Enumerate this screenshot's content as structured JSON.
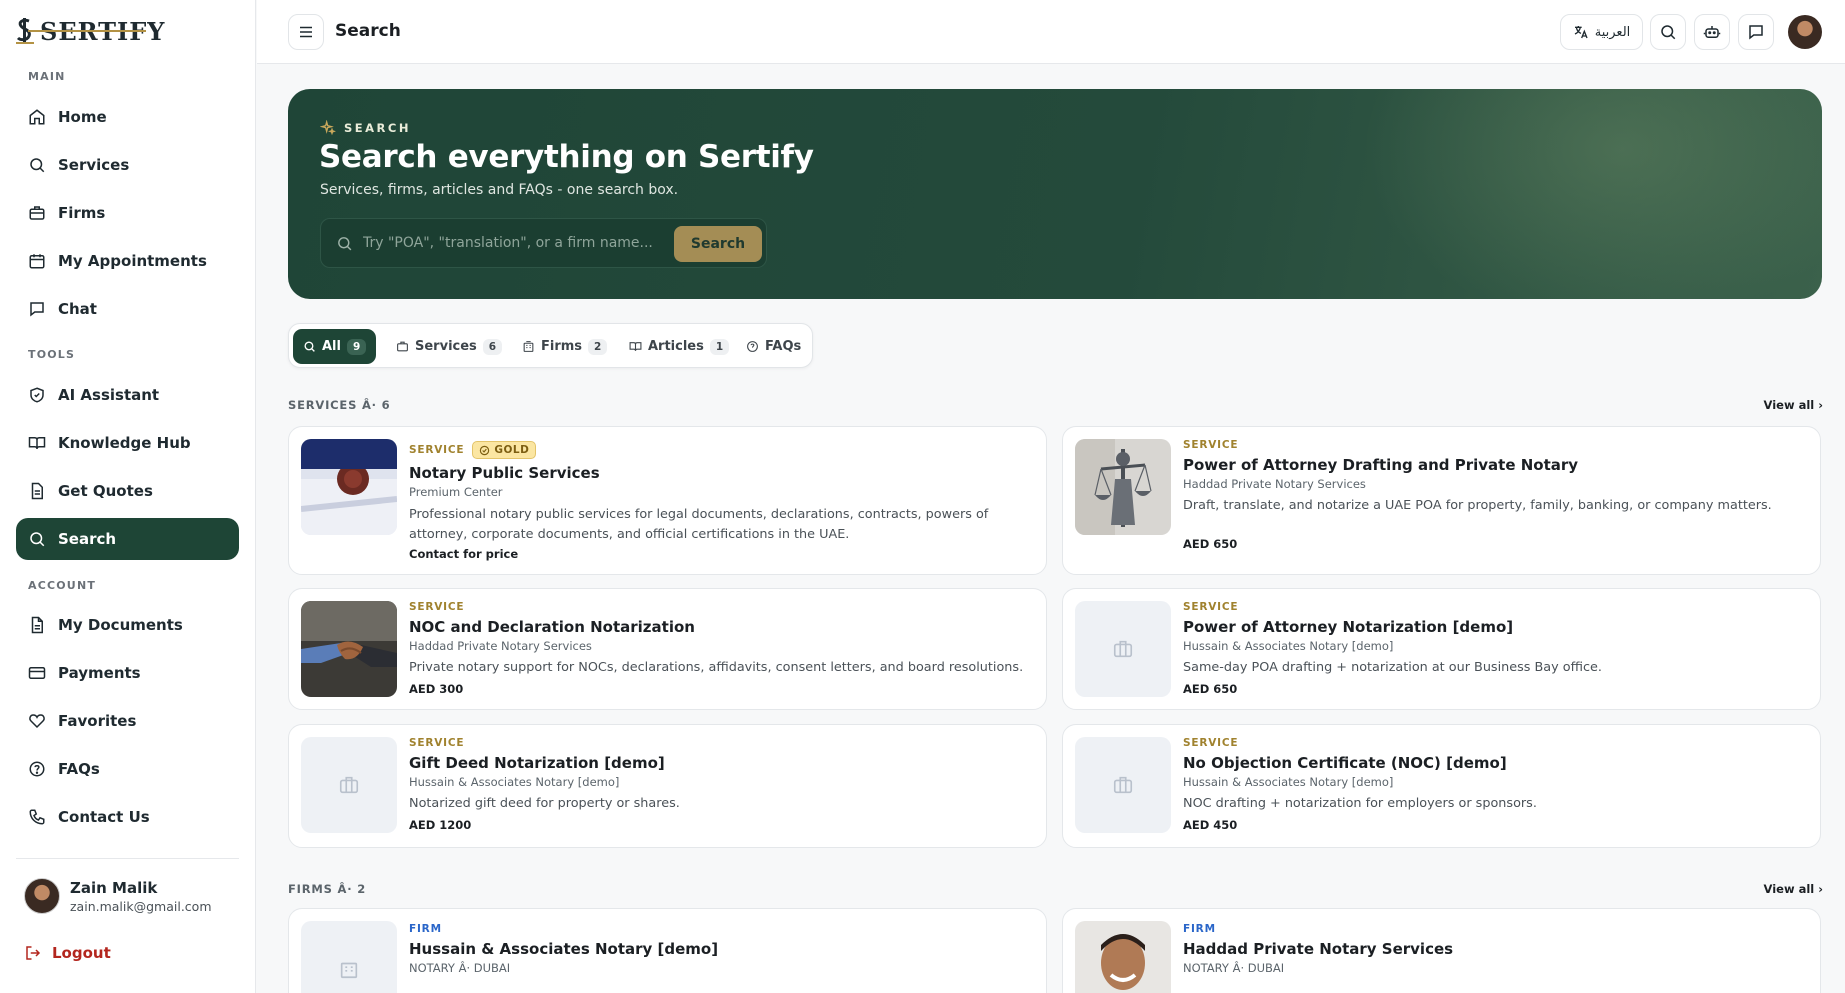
{
  "brand": {
    "name": "SERTIFY"
  },
  "sidebar": {
    "sections": {
      "main": "MAIN",
      "tools": "TOOLS",
      "account": "ACCOUNT"
    },
    "items": [
      {
        "label": "Home",
        "icon": "home-icon"
      },
      {
        "label": "Services",
        "icon": "search-icon"
      },
      {
        "label": "Firms",
        "icon": "briefcase-icon"
      },
      {
        "label": "My Appointments",
        "icon": "calendar-icon"
      },
      {
        "label": "Chat",
        "icon": "chat-icon"
      },
      {
        "label": "AI Assistant",
        "icon": "shield-icon"
      },
      {
        "label": "Knowledge Hub",
        "icon": "book-icon"
      },
      {
        "label": "Get Quotes",
        "icon": "document-icon"
      },
      {
        "label": "Search",
        "icon": "search-icon",
        "active": true
      },
      {
        "label": "My Documents",
        "icon": "file-icon"
      },
      {
        "label": "Payments",
        "icon": "credit-card-icon"
      },
      {
        "label": "Favorites",
        "icon": "heart-icon"
      },
      {
        "label": "FAQs",
        "icon": "help-circle-icon"
      },
      {
        "label": "Contact Us",
        "icon": "phone-icon"
      }
    ],
    "user": {
      "name": "Zain Malik",
      "email": "zain.malik@gmail.com"
    },
    "logout_label": "Logout"
  },
  "topbar": {
    "title": "Search",
    "language_label": "العربية"
  },
  "hero": {
    "eyebrow": "SEARCH",
    "title": "Search everything on Sertify",
    "subtitle": "Services, firms, articles and FAQs - one search box.",
    "search_placeholder": "Try \"POA\", \"translation\", or a firm name...",
    "search_button": "Search"
  },
  "tabs": [
    {
      "label": "All",
      "count": "9",
      "active": true
    },
    {
      "label": "Services",
      "count": "6"
    },
    {
      "label": "Firms",
      "count": "2"
    },
    {
      "label": "Articles",
      "count": "1"
    },
    {
      "label": "FAQs",
      "count": ""
    }
  ],
  "services_section": {
    "heading": "SERVICES Â· 6",
    "view_all": "View all",
    "cards": [
      {
        "kind": "SERVICE",
        "badge": "GOLD",
        "title": "Notary Public Services",
        "provider": "Premium Center",
        "description": "Professional notary public services for legal documents, declarations, contracts, powers of attorney, corporate documents, and official certifications in the UAE.",
        "price": "Contact for price"
      },
      {
        "kind": "SERVICE",
        "title": "Power of Attorney Drafting and Private Notary",
        "provider": "Haddad Private Notary Services",
        "description": "Draft, translate, and notarize a UAE POA for property, family, banking, or company matters.",
        "price": "AED 650"
      },
      {
        "kind": "SERVICE",
        "title": "NOC and Declaration Notarization",
        "provider": "Haddad Private Notary Services",
        "description": "Private notary support for NOCs, declarations, affidavits, consent letters, and board resolutions.",
        "price": "AED 300"
      },
      {
        "kind": "SERVICE",
        "title": "Power of Attorney Notarization [demo]",
        "provider": "Hussain & Associates Notary [demo]",
        "description": "Same-day POA drafting + notarization at our Business Bay office.",
        "price": "AED 650"
      },
      {
        "kind": "SERVICE",
        "title": "Gift Deed Notarization [demo]",
        "provider": "Hussain & Associates Notary [demo]",
        "description": "Notarized gift deed for property or shares.",
        "price": "AED 1200"
      },
      {
        "kind": "SERVICE",
        "title": "No Objection Certificate (NOC) [demo]",
        "provider": "Hussain & Associates Notary [demo]",
        "description": "NOC drafting + notarization for employers or sponsors.",
        "price": "AED 450"
      }
    ]
  },
  "firms_section": {
    "heading": "FIRMS Â· 2",
    "view_all": "View all",
    "cards": [
      {
        "kind": "FIRM",
        "title": "Hussain & Associates Notary [demo]",
        "meta": "NOTARY Â· DUBAI"
      },
      {
        "kind": "FIRM",
        "title": "Haddad Private Notary Services",
        "meta": "NOTARY Â· DUBAI"
      }
    ]
  },
  "colors": {
    "primary": "#1e4536",
    "accent_gold": "#a48d55",
    "service_label": "#a0822e",
    "firm_label": "#2a66c9",
    "logout": "#b3261e"
  }
}
